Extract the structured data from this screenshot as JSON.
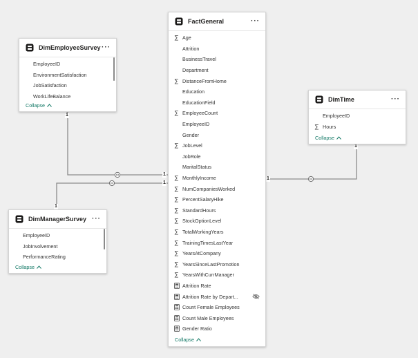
{
  "tables": {
    "fact_general": {
      "name": "FactGeneral",
      "fields": [
        {
          "label": "Age",
          "icon": "sigma"
        },
        {
          "label": "Attrition",
          "icon": "none"
        },
        {
          "label": "BusinessTravel",
          "icon": "none"
        },
        {
          "label": "Department",
          "icon": "none"
        },
        {
          "label": "DistanceFromHome",
          "icon": "sigma"
        },
        {
          "label": "Education",
          "icon": "none"
        },
        {
          "label": "EducationField",
          "icon": "none"
        },
        {
          "label": "EmployeeCount",
          "icon": "sigma"
        },
        {
          "label": "EmployeeID",
          "icon": "none"
        },
        {
          "label": "Gender",
          "icon": "none"
        },
        {
          "label": "JobLevel",
          "icon": "sigma"
        },
        {
          "label": "JobRole",
          "icon": "none"
        },
        {
          "label": "MaritalStatus",
          "icon": "none"
        },
        {
          "label": "MonthlyIncome",
          "icon": "sigma"
        },
        {
          "label": "NumCompaniesWorked",
          "icon": "sigma"
        },
        {
          "label": "PercentSalaryHike",
          "icon": "sigma"
        },
        {
          "label": "StandardHours",
          "icon": "sigma"
        },
        {
          "label": "StockOptionLevel",
          "icon": "sigma"
        },
        {
          "label": "TotalWorkingYears",
          "icon": "sigma"
        },
        {
          "label": "TrainingTimesLastYear",
          "icon": "sigma"
        },
        {
          "label": "YearsAtCompany",
          "icon": "sigma"
        },
        {
          "label": "YearsSinceLastPromotion",
          "icon": "sigma"
        },
        {
          "label": "YearsWithCurrManager",
          "icon": "sigma"
        },
        {
          "label": "Attrition Rate",
          "icon": "measure"
        },
        {
          "label": "Attrition Rate by Depart...",
          "icon": "measure",
          "hidden": true
        },
        {
          "label": "Count Female Employees",
          "icon": "measure"
        },
        {
          "label": "Count Male Employees",
          "icon": "measure"
        },
        {
          "label": "Gender Ratio",
          "icon": "measure"
        }
      ],
      "collapse_label": "Collapse"
    },
    "dim_employee_survey": {
      "name": "DimEmployeeSurvey",
      "fields": [
        {
          "label": "EmployeeID",
          "icon": "none"
        },
        {
          "label": "EnvironmentSatisfaction",
          "icon": "none"
        },
        {
          "label": "JobSatisfaction",
          "icon": "none"
        },
        {
          "label": "WorkLifeBalance",
          "icon": "none"
        }
      ],
      "collapse_label": "Collapse"
    },
    "dim_manager_survey": {
      "name": "DimManagerSurvey",
      "fields": [
        {
          "label": "EmployeeID",
          "icon": "none"
        },
        {
          "label": "JobInvolvement",
          "icon": "none"
        },
        {
          "label": "PerformanceRating",
          "icon": "none"
        }
      ],
      "collapse_label": "Collapse"
    },
    "dim_time": {
      "name": "DimTime",
      "fields": [
        {
          "label": "EmployeeID",
          "icon": "none"
        },
        {
          "label": "Hours",
          "icon": "sigma"
        }
      ],
      "collapse_label": "Collapse"
    }
  },
  "more_label": "···",
  "cardinality": {
    "one": "1"
  },
  "colors": {
    "line": "#8c8c8c",
    "accent": "#117865",
    "background": "#efefef"
  }
}
